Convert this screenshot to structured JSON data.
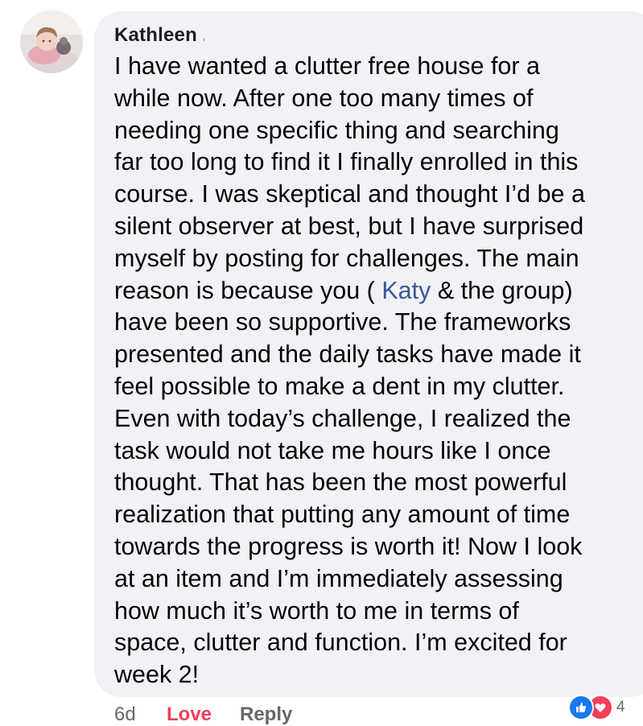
{
  "comment": {
    "author": "Kathleen .",
    "text_before_mention": [
      "I have wanted a clutter free house for a",
      "while now.  After one too many times of",
      "needing one specific thing and searching",
      "far too long to find it I finally enrolled in this",
      "course.  I was skeptical and thought I’d be a",
      "silent observer at best, but I have surprised",
      "myself by posting for challenges.   The main"
    ],
    "mention_line_prefix": "reason is because you ( ",
    "mention": "Katy",
    "mention_line_suffix": "  & the group)",
    "text_after_mention": [
      "have been so supportive.  The frameworks",
      "presented and the daily tasks have made it",
      "feel possible to make a dent in my clutter.",
      "Even with today’s challenge, I realized the",
      "task would not take me hours like I once",
      "thought.  That has been the most powerful",
      "realization that putting any amount of time",
      "towards the progress is worth it! Now I look",
      "at an item and I’m immediately assessing",
      "how much it’s worth to me in terms of",
      "space, clutter and function.  I’m excited for",
      "week 2!"
    ]
  },
  "actions": {
    "timestamp": "6d",
    "reaction_label": "Love",
    "reply_label": "Reply"
  },
  "reactions": {
    "icons": [
      "like-icon",
      "heart-icon"
    ],
    "count": "4"
  },
  "colors": {
    "bubble": "#f0f2f5",
    "mention": "#385898",
    "love": "#f33e58",
    "like": "#1877f2",
    "muted": "#65676b"
  }
}
